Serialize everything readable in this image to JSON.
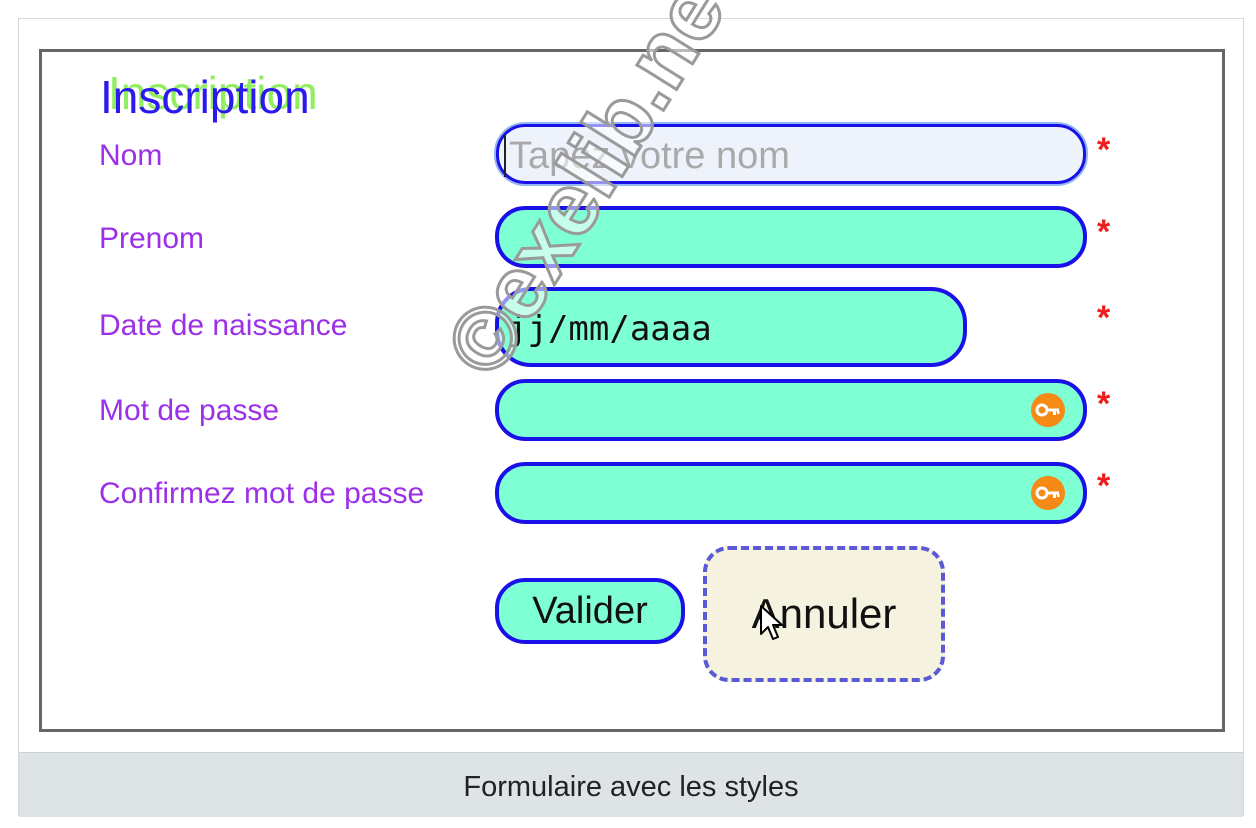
{
  "form": {
    "legend": "Inscription",
    "fields": {
      "nom": {
        "label": "Nom",
        "placeholder": "Tapez votre nom",
        "required_mark": "*"
      },
      "prenom": {
        "label": "Prenom",
        "required_mark": "*"
      },
      "date": {
        "label": "Date de naissance",
        "value_display": "jj/mm/aaaa",
        "required_mark": "*"
      },
      "password": {
        "label": "Mot de passe",
        "icon": "key-icon",
        "required_mark": "*"
      },
      "password_confirm": {
        "label": "Confirmez mot de passe",
        "icon": "key-icon",
        "required_mark": "*"
      }
    },
    "buttons": {
      "submit_label": "Valider",
      "cancel_label": "Annuler"
    }
  },
  "watermark": "©exelib.net",
  "caption": "Formulaire avec les styles",
  "colors": {
    "input_fill": "#7fffd4",
    "input_border": "#1a10e8",
    "label": "#9b30e8",
    "legend": "#2a1aee",
    "legend_shadow": "#90ee60",
    "required": "#ee1c1c",
    "cancel_fill": "#f5f2df",
    "cancel_border": "#5a5ad6",
    "caption_bar": "#dee3e6",
    "key_icon": "#f58a16"
  }
}
